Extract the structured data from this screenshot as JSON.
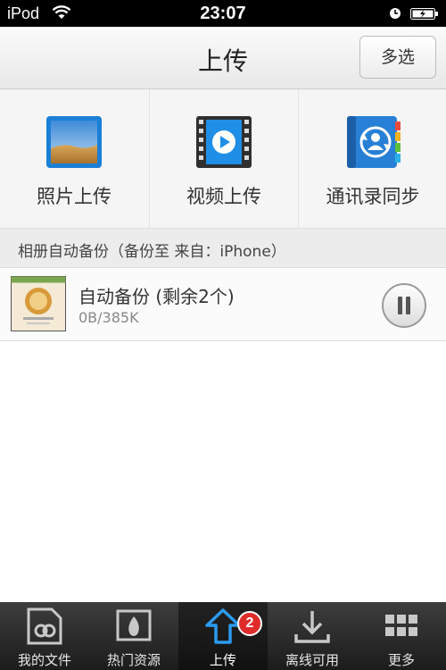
{
  "status_bar": {
    "carrier": "iPod",
    "time": "23:07"
  },
  "nav": {
    "title": "上传",
    "multi_select": "多选"
  },
  "actions": [
    {
      "label": "照片上传",
      "icon": "photo-icon"
    },
    {
      "label": "视频上传",
      "icon": "video-icon"
    },
    {
      "label": "通讯录同步",
      "icon": "contacts-sync-icon"
    }
  ],
  "section": {
    "header": "相册自动备份（备份至 来自：iPhone）"
  },
  "upload_item": {
    "title": "自动备份 (剩余2个)",
    "progress": "0B/385K"
  },
  "tabs": [
    {
      "label": "我的文件",
      "icon": "my-files-icon"
    },
    {
      "label": "热门资源",
      "icon": "hot-resources-icon"
    },
    {
      "label": "上传",
      "icon": "upload-icon",
      "badge": "2",
      "active": true
    },
    {
      "label": "离线可用",
      "icon": "offline-icon"
    },
    {
      "label": "更多",
      "icon": "more-icon"
    }
  ],
  "colors": {
    "accent": "#1a8be0",
    "badge": "#e02b2b",
    "tabbar": "#2a2a2a"
  }
}
